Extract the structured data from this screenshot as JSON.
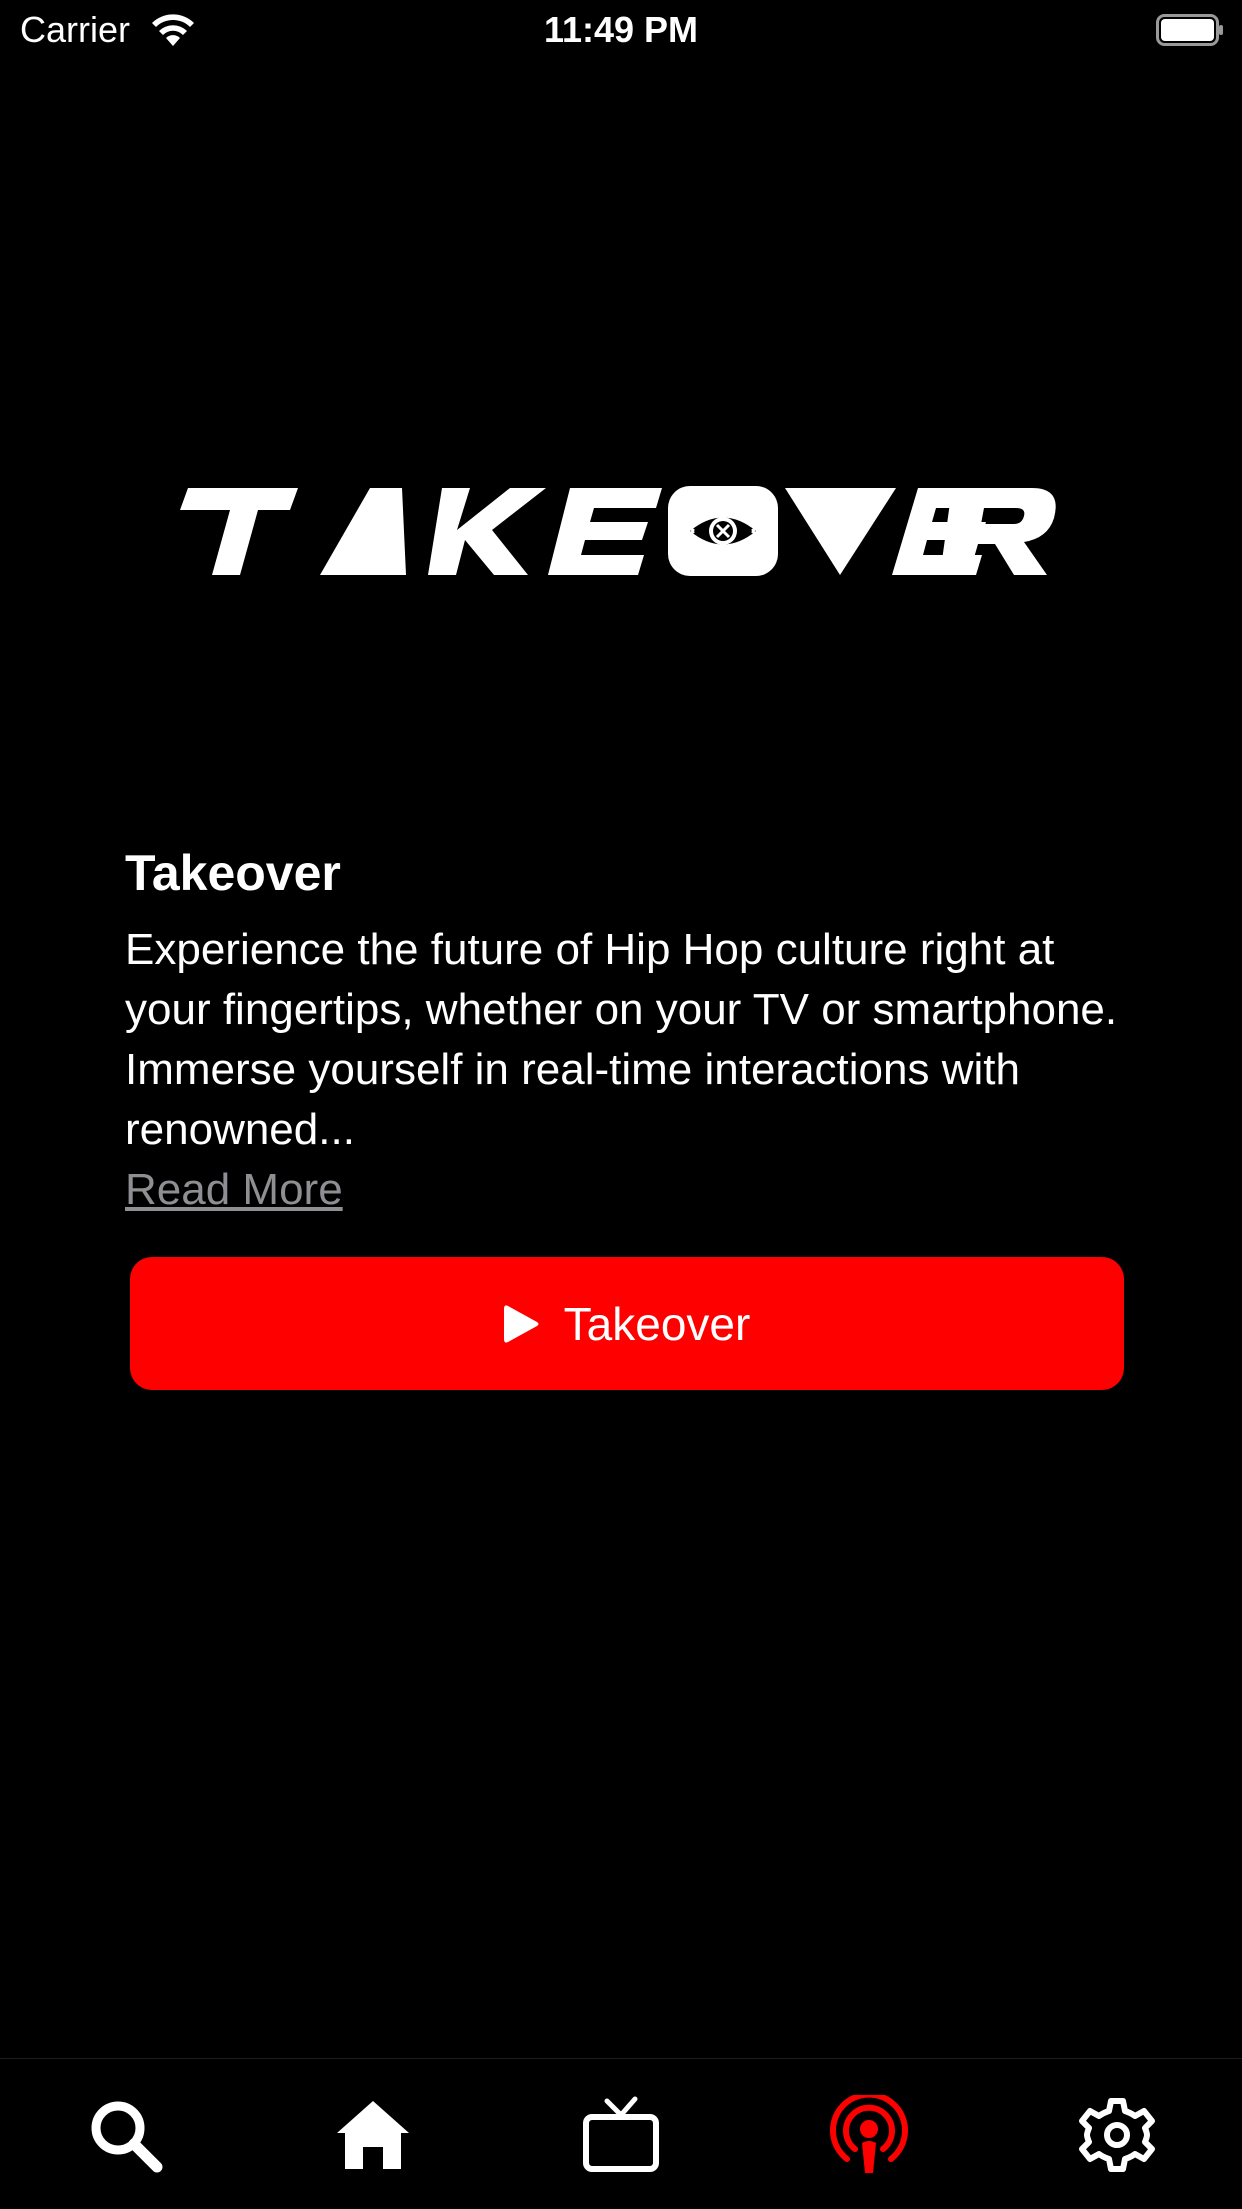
{
  "status_bar": {
    "carrier": "Carrier",
    "time": "11:49 PM",
    "wifi_icon": "wifi-icon",
    "battery_icon": "battery-icon"
  },
  "logo": {
    "text": "TAKEOVER",
    "icon": "takeover-logo"
  },
  "info": {
    "title": "Takeover",
    "description": "Experience the future of Hip Hop culture right at your fingertips, whether on your TV or smartphone. Immerse yourself in real-time interactions with renowned...",
    "read_more": "Read More"
  },
  "play_button": {
    "label": "Takeover",
    "icon": "play-icon"
  },
  "tab_bar": {
    "tabs": [
      {
        "name": "search",
        "icon": "search-icon",
        "active": false
      },
      {
        "name": "home",
        "icon": "home-icon",
        "active": false
      },
      {
        "name": "tv",
        "icon": "tv-icon",
        "active": false
      },
      {
        "name": "podcast",
        "icon": "podcast-icon",
        "active": true
      },
      {
        "name": "settings",
        "icon": "gear-icon",
        "active": false
      }
    ]
  },
  "colors": {
    "background": "#000000",
    "accent": "#ff0000",
    "text": "#ffffff",
    "muted": "#8e8e93"
  }
}
